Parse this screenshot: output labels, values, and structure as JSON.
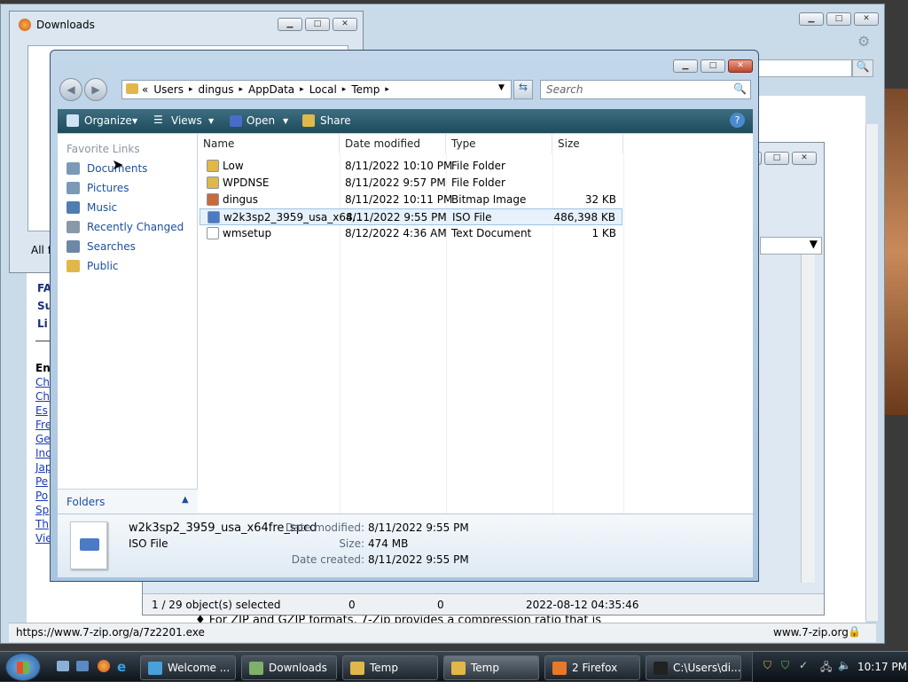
{
  "firefox": {
    "status_url": "https://www.7-zip.org/a/7z2201.exe",
    "status_domain": "www.7-zip.org",
    "page_links": [
      "Ch",
      "Ch",
      "Es",
      "Fre",
      "Ge",
      "Inc",
      "Jap",
      "Pe",
      "Po",
      "Sp",
      "Th",
      "Vie"
    ],
    "page_heading": "En",
    "nav_bits": [
      "FA",
      "Su",
      "Li"
    ],
    "body_fragment": "For ZIP and GZIP formats, 7-Zip provides a compression ratio that is"
  },
  "downloads": {
    "title": "Downloads",
    "footer": "All f"
  },
  "zip": {
    "status": [
      "1 / 29 object(s) selected",
      "0",
      "0",
      "2022-08-12 04:35:46"
    ]
  },
  "explorer": {
    "breadcrumb": [
      "«",
      "Users",
      "dingus",
      "AppData",
      "Local",
      "Temp"
    ],
    "search_placeholder": "Search",
    "commands": [
      "Organize",
      "Views",
      "Open",
      "Share"
    ],
    "favorite_links_title": "Favorite Links",
    "nav_items": [
      {
        "label": "Documents",
        "color": "#7a9ab8"
      },
      {
        "label": "Pictures",
        "color": "#7a9ab8"
      },
      {
        "label": "Music",
        "color": "#4f7db0"
      },
      {
        "label": "Recently Changed",
        "color": "#8a99aa"
      },
      {
        "label": "Searches",
        "color": "#6c88a6"
      },
      {
        "label": "Public",
        "color": "#e0b84a"
      }
    ],
    "folders_label": "Folders",
    "columns": [
      "Name",
      "Date modified",
      "Type",
      "Size"
    ],
    "files": [
      {
        "name": "Low",
        "date": "8/11/2022 10:10 PM",
        "type": "File Folder",
        "size": "",
        "icon": "folder"
      },
      {
        "name": "WPDNSE",
        "date": "8/11/2022 9:57 PM",
        "type": "File Folder",
        "size": "",
        "icon": "folder"
      },
      {
        "name": "dingus",
        "date": "8/11/2022 10:11 PM",
        "type": "Bitmap Image",
        "size": "32 KB",
        "icon": "bitmap"
      },
      {
        "name": "w2k3sp2_3959_usa_x64...",
        "date": "8/11/2022 9:55 PM",
        "type": "ISO File",
        "size": "486,398 KB",
        "icon": "iso"
      },
      {
        "name": "wmsetup",
        "date": "8/12/2022 4:36 AM",
        "type": "Text Document",
        "size": "1 KB",
        "icon": "text"
      }
    ],
    "selected_index": 3,
    "details": {
      "filename": "w2k3sp2_3959_usa_x64fre_spcd",
      "filetype": "ISO File",
      "date_modified_label": "Date modified:",
      "date_modified": "8/11/2022 9:55 PM",
      "size_label": "Size:",
      "size": "474 MB",
      "date_created_label": "Date created:",
      "date_created": "8/11/2022 9:55 PM"
    }
  },
  "taskbar": {
    "buttons": [
      {
        "label": "Welcome ...",
        "color": "#4aa0d8"
      },
      {
        "label": "Downloads",
        "color": "#7fb06a"
      },
      {
        "label": "Temp",
        "color": "#e0b84a"
      },
      {
        "label": "Temp",
        "color": "#e0b84a"
      },
      {
        "label": "2 Firefox",
        "color": "#e8782a"
      },
      {
        "label": "C:\\Users\\di...",
        "color": "#222"
      }
    ],
    "clock": "10:17 PM"
  }
}
